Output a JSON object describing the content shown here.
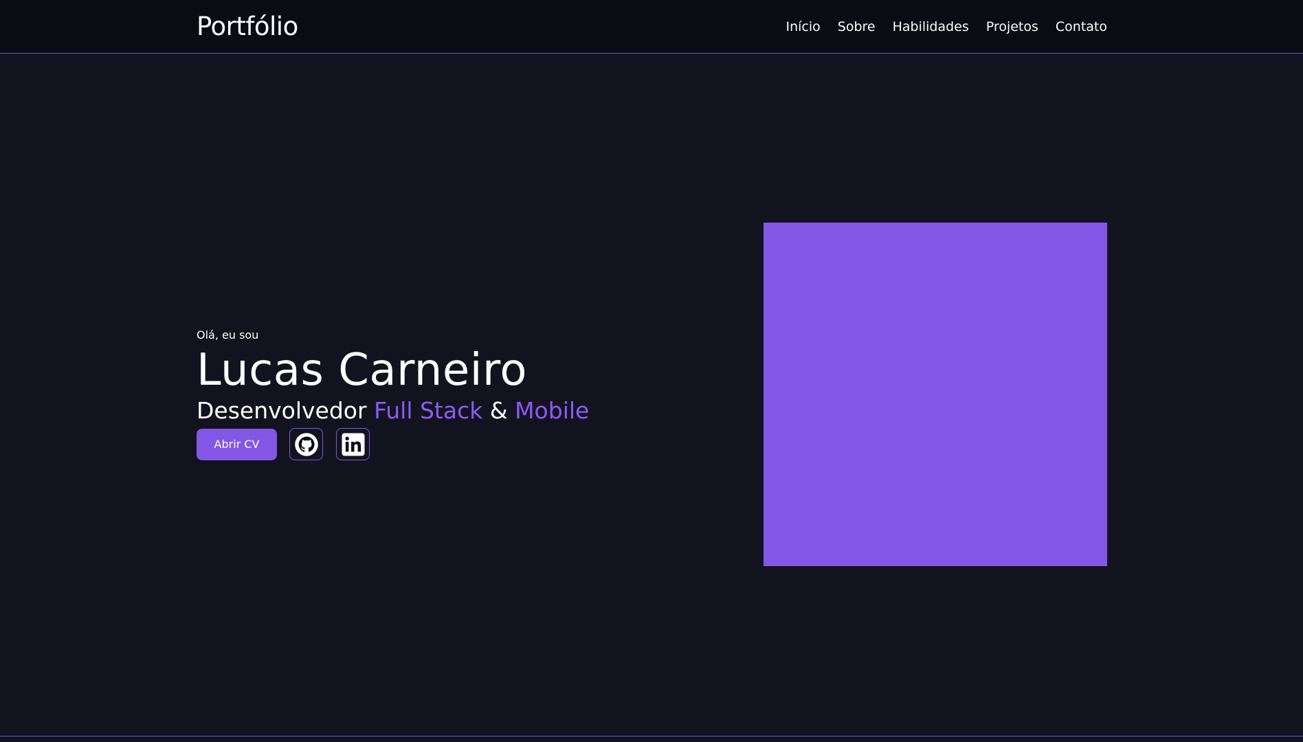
{
  "header": {
    "logo": "Portfólio",
    "nav": [
      "Início",
      "Sobre",
      "Habilidades",
      "Projetos",
      "Contato"
    ]
  },
  "hero": {
    "greeting": "Olá, eu sou",
    "name": "Lucas Carneiro",
    "role_prefix": "Desenvolvedor",
    "role_highlight_1": "Full Stack",
    "role_connector": "&",
    "role_highlight_2": "Mobile",
    "cv_button_label": "Abrir CV",
    "social": [
      "github-icon",
      "linkedin-icon"
    ]
  },
  "colors": {
    "background": "#13131f",
    "navbar": "#0b0b14",
    "accent": "#8257e5",
    "accent_text": "#8b5cf6",
    "border": "#6f55d8"
  }
}
